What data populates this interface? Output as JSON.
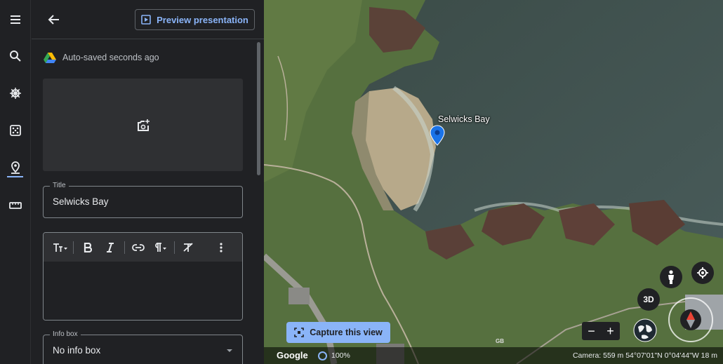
{
  "rail": {
    "items": [
      {
        "name": "menu"
      },
      {
        "name": "search"
      },
      {
        "name": "voyager"
      },
      {
        "name": "feeling-lucky"
      },
      {
        "name": "projects"
      },
      {
        "name": "measure"
      }
    ],
    "active": "projects"
  },
  "panel": {
    "preview_label": "Preview presentation",
    "autosave_text": "Auto-saved seconds ago",
    "title_field": {
      "label": "Title",
      "value": "Selwicks Bay"
    },
    "info_box_field": {
      "label": "Info box",
      "value": "No info box"
    }
  },
  "map": {
    "place_label": "Selwicks Bay",
    "capture_label": "Capture this view",
    "three_d_label": "3D",
    "zoom_in": "+",
    "zoom_out": "−",
    "logo": "Google",
    "load_percent": "100%",
    "camera_info": "Camera: 559 m   54°07'01\"N 0°04'44\"W   18 m",
    "gb_mark": "GB"
  },
  "colors": {
    "accent": "#8ab4f8",
    "background": "#202124",
    "pin": "#1a73e8"
  }
}
